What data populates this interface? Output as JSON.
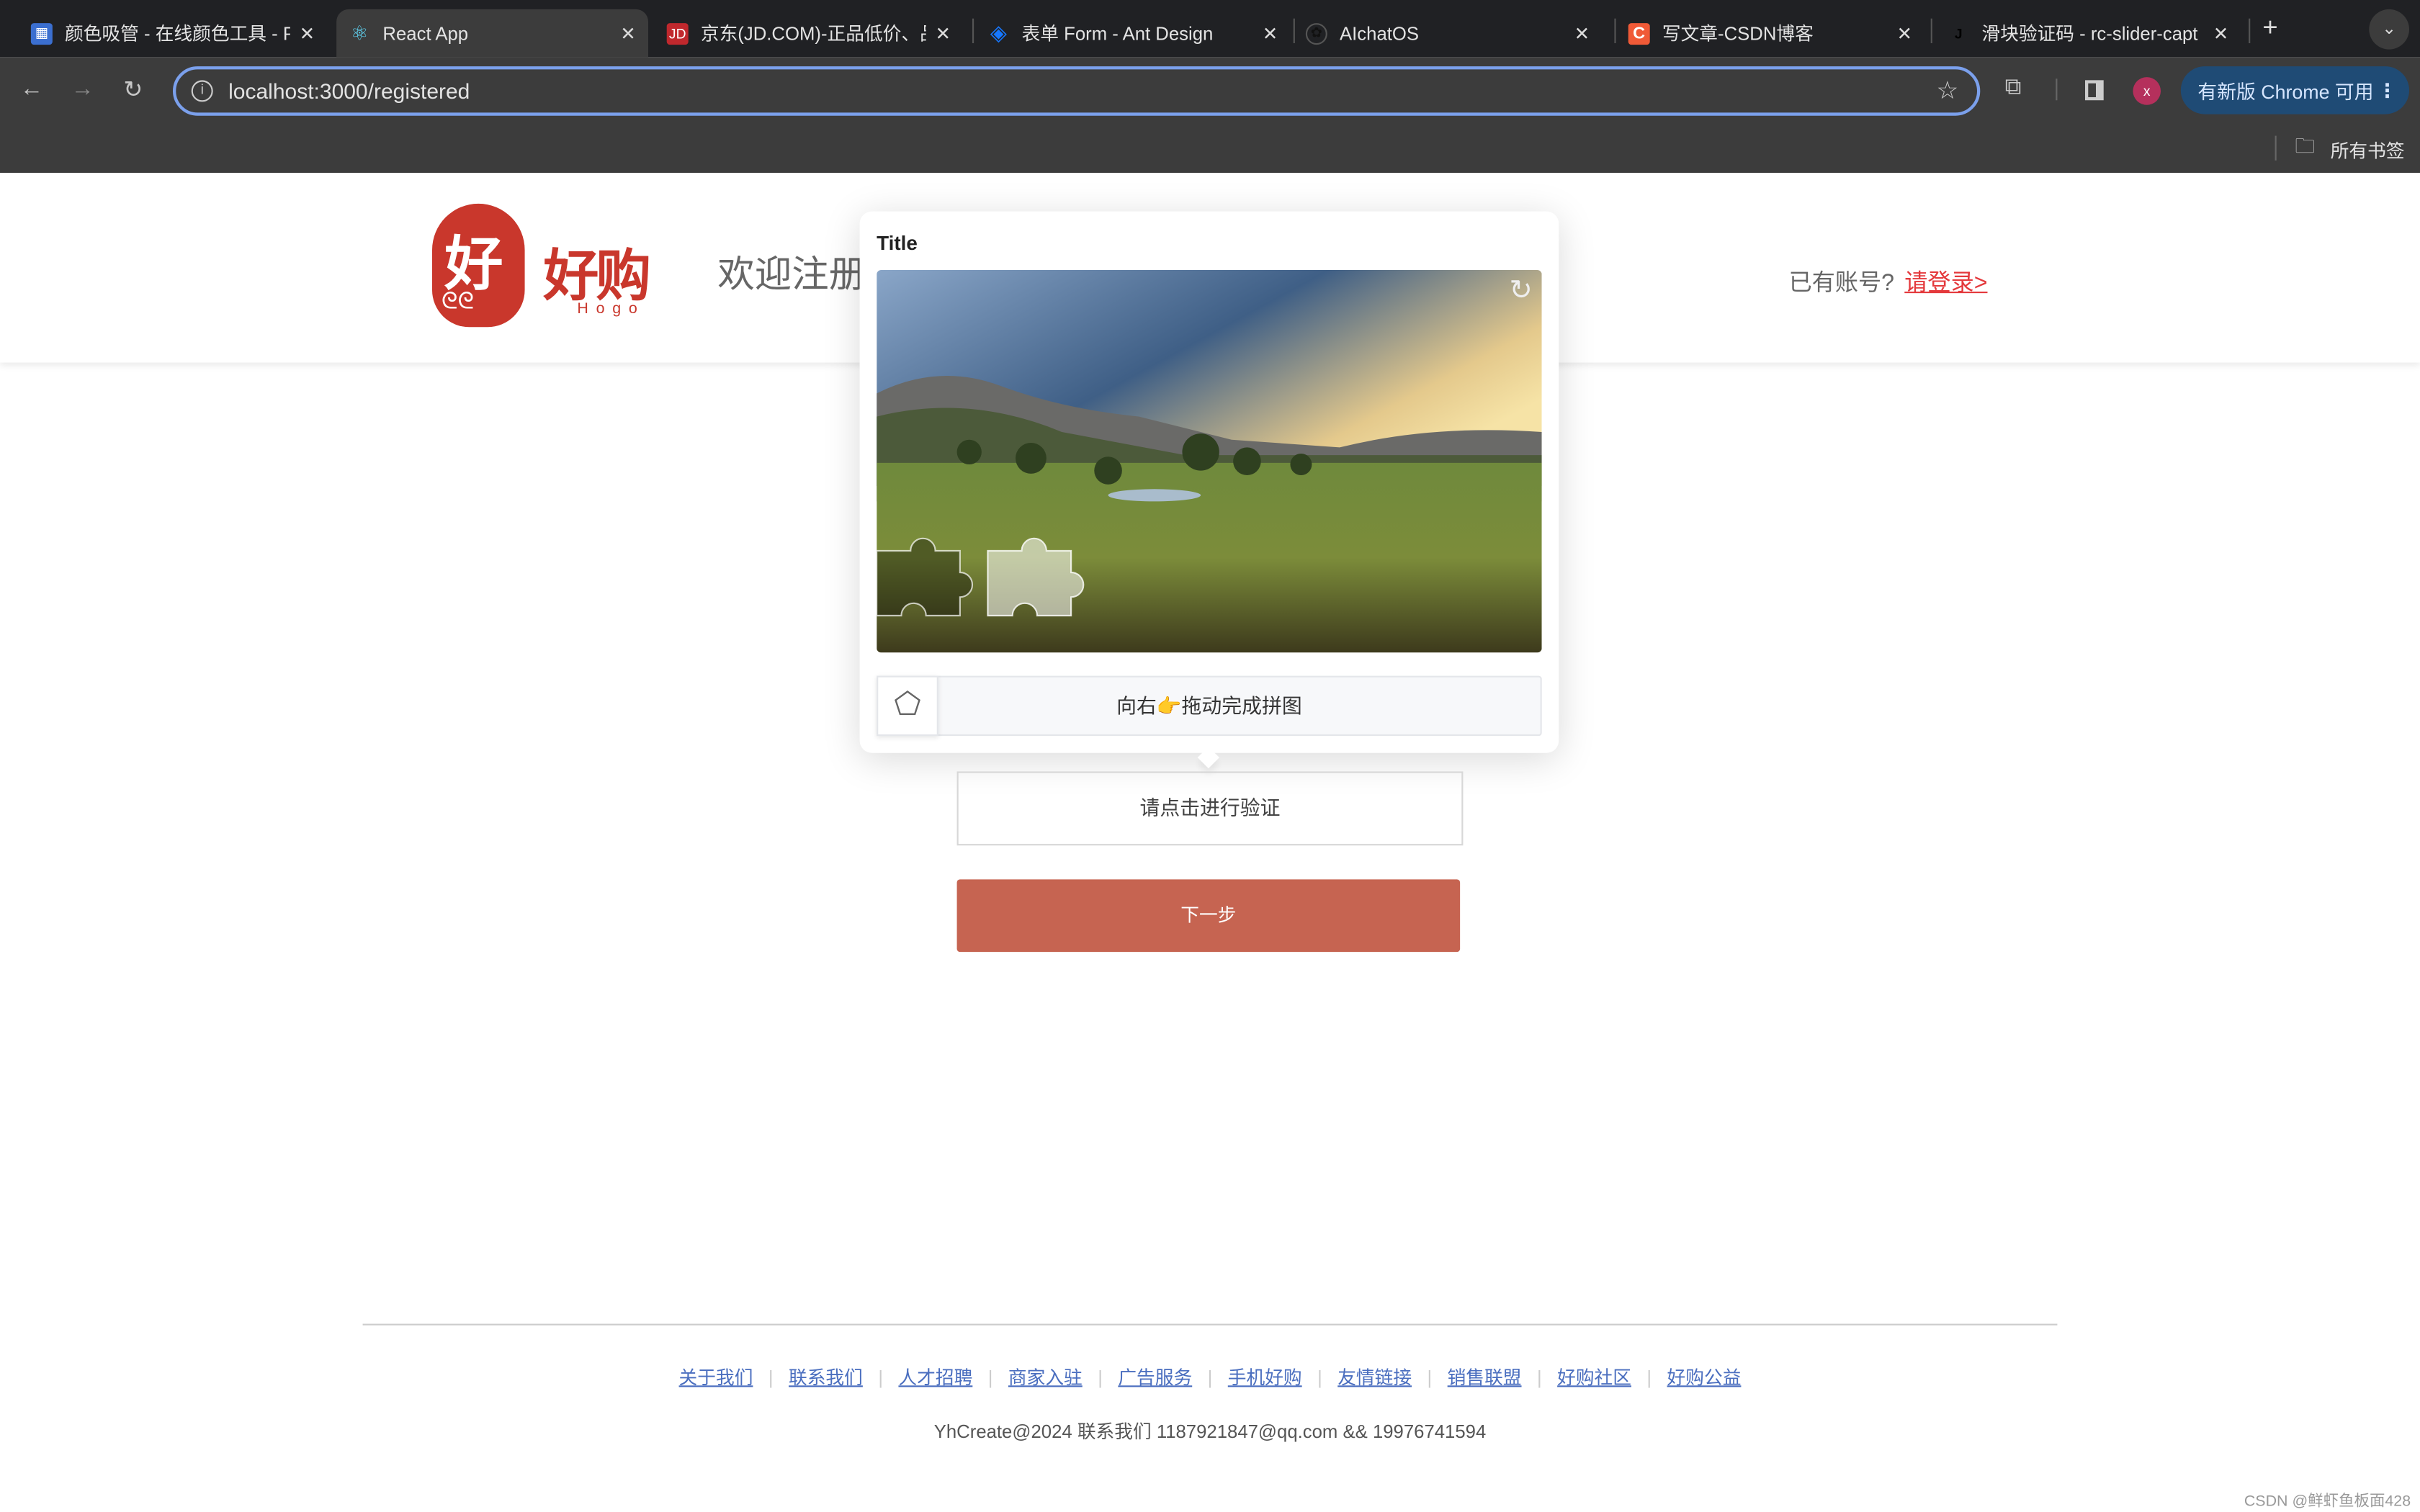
{
  "browser": {
    "tabs": [
      {
        "title": "颜色吸管 - 在线颜色工具 - P",
        "icon": "color-picker-icon",
        "active": false
      },
      {
        "title": "React App",
        "icon": "react-icon",
        "active": true
      },
      {
        "title": "京东(JD.COM)-正品低价、品",
        "icon": "jd-icon",
        "active": false
      },
      {
        "title": "表单 Form - Ant Design",
        "icon": "ant-design-icon",
        "active": false
      },
      {
        "title": "AIchatOS",
        "icon": "openai-icon",
        "active": false
      },
      {
        "title": "写文章-CSDN博客",
        "icon": "csdn-icon",
        "active": false
      },
      {
        "title": "滑块验证码 - rc-slider-capt",
        "icon": "page-icon",
        "active": false
      }
    ],
    "url": "localhost:3000/registered",
    "update_label": "有新版 Chrome 可用",
    "profile_initial": "x",
    "bookmarks_label": "所有书签"
  },
  "header": {
    "logo_char": "好",
    "logo_name": "好购",
    "logo_sub": "Hogo",
    "welcome": "欢迎注册",
    "has_account": "已有账号?",
    "login_link": "请登录>"
  },
  "captcha": {
    "title": "Title",
    "slider_hint": "向右👉拖动完成拼图",
    "icons": {
      "refresh": "refresh-icon",
      "handle": "puzzle-handle-icon"
    }
  },
  "form": {
    "verify_label": "请点击进行验证",
    "next_label": "下一步"
  },
  "footer": {
    "links": [
      "关于我们",
      "联系我们",
      "人才招聘",
      "商家入驻",
      "广告服务",
      "手机好购",
      "友情链接",
      "销售联盟",
      "好购社区",
      "好购公益"
    ],
    "copyright": "YhCreate@2024 联系我们 1187921847@qq.com && 19976741594"
  },
  "watermark": "CSDN @鲜虾鱼板面428",
  "colors": {
    "brand": "#c9372c",
    "button": "#c66451",
    "link": "#4a6ebf",
    "login": "#e4393c",
    "omnibox_focus": "#7ba0ec"
  }
}
